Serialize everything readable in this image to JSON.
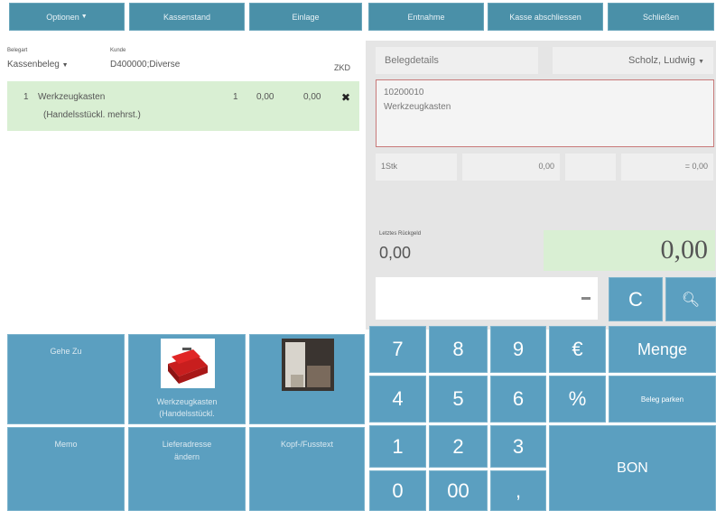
{
  "topbar": {
    "optionen": "Optionen",
    "kassenstand": "Kassenstand",
    "einlage": "Einlage",
    "entnahme": "Entnahme",
    "kasse_abschliessen": "Kasse abschliessen",
    "schliessen": "Schließen"
  },
  "receipt": {
    "belegart_label": "Belegart",
    "belegart_value": "Kassenbeleg",
    "kunde_label": "Kunde",
    "kunde_value": "D400000;Diverse",
    "zkd": "ZKD",
    "position": {
      "nr": "1",
      "name": "Werkzeugkasten",
      "subtitle": "(Handelsstückl. mehrst.)",
      "qty": "1",
      "price": "0,00",
      "total": "0,00",
      "delete_icon": "✖"
    }
  },
  "details": {
    "belegdetails": "Belegdetails",
    "user": "Scholz, Ludwig",
    "article_number": "10200010",
    "article_name": "Werkzeugkasten",
    "unit": "1Stk",
    "unit_price": "0,00",
    "line_total": "= 0,00",
    "last_change_label": "Letztes Rückgeld",
    "last_change_value": "0,00",
    "total": "0,00"
  },
  "keypad": {
    "clear": "C",
    "keys": [
      "7",
      "8",
      "9",
      "€",
      "4",
      "5",
      "6",
      "%",
      "1",
      "2",
      "3",
      "0",
      "00",
      ","
    ],
    "menge": "Menge",
    "beleg_parken": "Beleg parken",
    "bon": "BON"
  },
  "tiles": {
    "gehe_zu": "Gehe Zu",
    "werkzeugkasten": "Werkzeugkasten (Handelsstückl.",
    "memo": "Memo",
    "lieferadresse": "Lieferadresse ändern",
    "kopf_fusstext": "Kopf-/Fusstext"
  },
  "colors": {
    "accent": "#4a90a8",
    "key": "#5b9fc0",
    "highlight": "#d9efd3",
    "border_red": "#c87a7a"
  }
}
